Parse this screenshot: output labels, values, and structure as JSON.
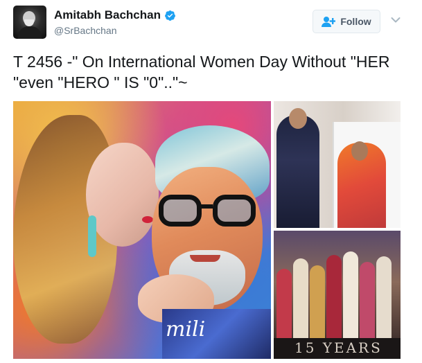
{
  "tweet": {
    "author_name": "Amitabh Bachchan",
    "author_handle": "@SrBachchan",
    "verified": true,
    "follow_label": "Follow",
    "text": "T 2456 -\" On International Women Day Without \"HER \"even \"HERO \" IS \"0\"..\"~"
  },
  "media": {
    "main_image_caption": "mili",
    "bottom_image_caption": "15 YEARS"
  },
  "colors": {
    "verified_blue": "#1da1f2",
    "follow_icon": "#1da1f2",
    "handle_gray": "#657786"
  },
  "icons": {
    "verified": "verified-badge-icon",
    "follow": "add-user-icon",
    "more": "chevron-down-icon"
  }
}
